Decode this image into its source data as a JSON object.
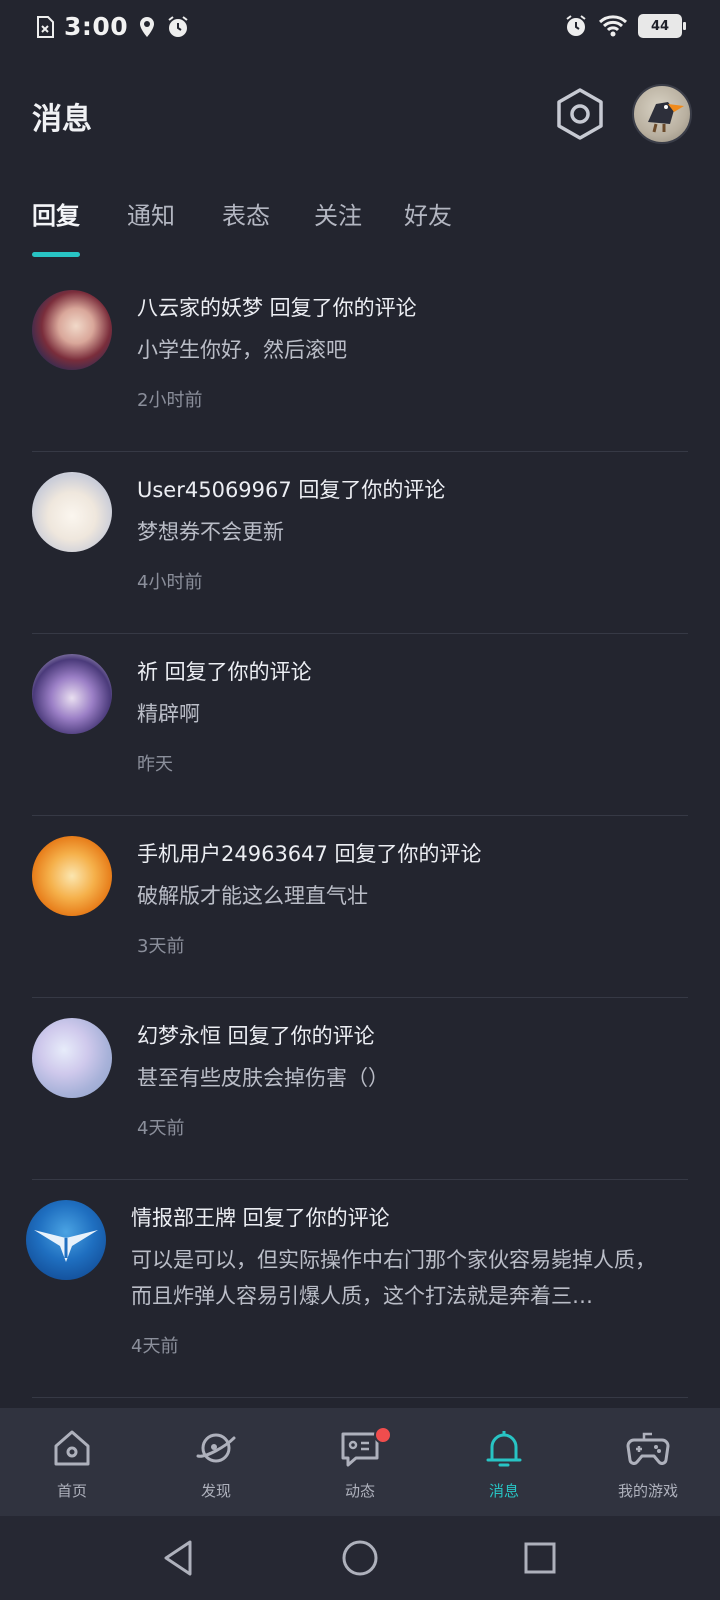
{
  "status_bar": {
    "time": "3:00",
    "battery": "44"
  },
  "header": {
    "title": "消息"
  },
  "tabs": [
    {
      "label": "回复",
      "active": true
    },
    {
      "label": "通知",
      "active": false
    },
    {
      "label": "表态",
      "active": false
    },
    {
      "label": "关注",
      "active": false
    },
    {
      "label": "好友",
      "active": false
    }
  ],
  "messages": [
    {
      "title": "八云家的妖梦 回复了你的评论",
      "body": "小学生你好，然后滚吧",
      "time": "2小时前"
    },
    {
      "title": "User45069967 回复了你的评论",
      "body": "梦想券不会更新",
      "time": "4小时前"
    },
    {
      "title": "祈 回复了你的评论",
      "body": "精辟啊",
      "time": "昨天"
    },
    {
      "title": "手机用户24963647 回复了你的评论",
      "body": "破解版才能这么理直气壮",
      "time": "3天前"
    },
    {
      "title": "幻梦永恒 回复了你的评论",
      "body": "甚至有些皮肤会掉伤害（）",
      "time": "4天前"
    },
    {
      "title": "情报部王牌 回复了你的评论",
      "body": "可以是可以，但实际操作中右门那个家伙容易毙掉人质，而且炸弹人容易引爆人质，这个打法就是奔着三…",
      "time": "4天前"
    }
  ],
  "bottom_nav": [
    {
      "label": "首页",
      "icon": "home-icon"
    },
    {
      "label": "发现",
      "icon": "planet-icon"
    },
    {
      "label": "动态",
      "icon": "chat-icon",
      "badge": true
    },
    {
      "label": "消息",
      "icon": "bell-icon",
      "active": true
    },
    {
      "label": "我的游戏",
      "icon": "gamepad-icon"
    }
  ],
  "colors": {
    "accent": "#28c4c4",
    "background": "#23252f",
    "badge": "#f04d4d"
  }
}
